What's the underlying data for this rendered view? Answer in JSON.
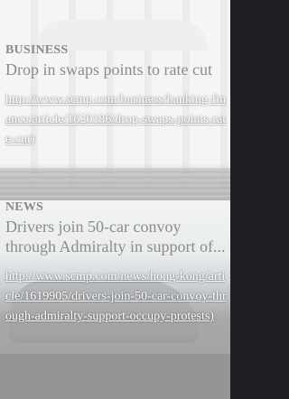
{
  "articles": [
    {
      "category": "BUSINESS",
      "headline": "Drop in swaps points to rate cut",
      "url": "http://www.scmp.com/business/banking-finance/article/1620186/drop-swaps-points-rate-cut)"
    },
    {
      "category": "NEWS",
      "headline": "Drivers join 50-car convoy through Admiralty in support of...",
      "url": "http://www.scmp.com/news/hong-kong/article/1619905/drivers-join-50-car-convoy-through-admiralty-support-occupy-protests)"
    }
  ]
}
